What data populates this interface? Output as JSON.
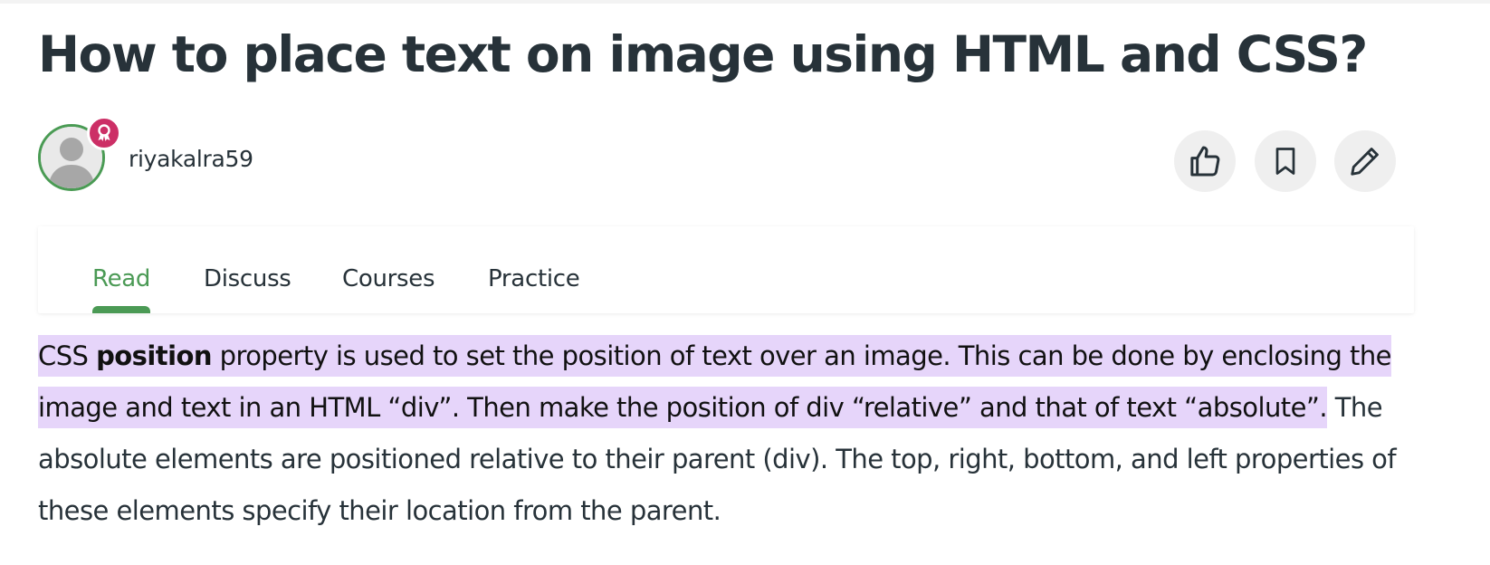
{
  "article": {
    "title": "How to place text on image using HTML and CSS?",
    "author": "riyakalra59"
  },
  "actions": {
    "like_icon": "thumbs-up-icon",
    "bookmark_icon": "bookmark-icon",
    "edit_icon": "pencil-icon"
  },
  "tabs": [
    {
      "label": "Read",
      "active": true
    },
    {
      "label": "Discuss",
      "active": false
    },
    {
      "label": "Courses",
      "active": false
    },
    {
      "label": "Practice",
      "active": false
    }
  ],
  "body": {
    "p1_hl_a": "CSS ",
    "p1_hl_bold": "position",
    "p1_hl_b": " property is used to set the position of text over an image. This can be done by enclosing the image and text in an HTML “div”. Then make the position of div “relative” and that of text “absolute”.",
    "p1_rest": " The absolute elements are positioned relative to their parent (div). The top, right, bottom, and left properties of these elements specify their location from the parent."
  },
  "colors": {
    "accent": "#4b9a55",
    "highlight": "#e6d5fa",
    "badge": "#cc2f66",
    "text": "#273239"
  }
}
